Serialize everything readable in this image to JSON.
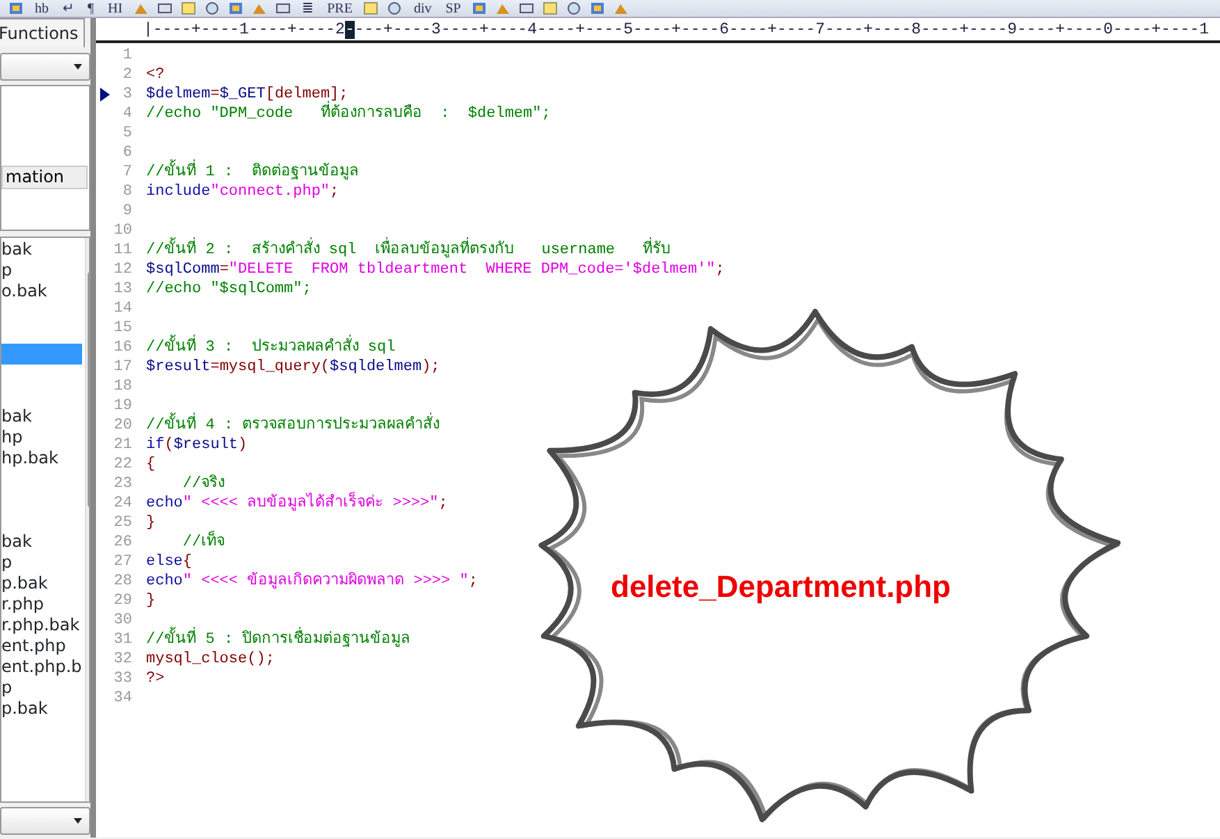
{
  "toolbar": {
    "items": [
      {
        "kind": "icon"
      },
      {
        "kind": "text",
        "label": "hb"
      },
      {
        "kind": "text",
        "label": "↵"
      },
      {
        "kind": "text",
        "label": "¶"
      },
      {
        "kind": "text",
        "label": "HI"
      },
      {
        "kind": "icon"
      },
      {
        "kind": "icon"
      },
      {
        "kind": "icon"
      },
      {
        "kind": "icon"
      },
      {
        "kind": "icon"
      },
      {
        "kind": "icon"
      },
      {
        "kind": "icon"
      },
      {
        "kind": "text",
        "label": "≣"
      },
      {
        "kind": "text",
        "label": "PRE"
      },
      {
        "kind": "icon"
      },
      {
        "kind": "icon"
      },
      {
        "kind": "text",
        "label": "div"
      },
      {
        "kind": "text",
        "label": "SP"
      },
      {
        "kind": "icon"
      },
      {
        "kind": "icon"
      },
      {
        "kind": "icon"
      },
      {
        "kind": "icon"
      },
      {
        "kind": "icon"
      },
      {
        "kind": "icon"
      },
      {
        "kind": "icon"
      }
    ]
  },
  "sidebar": {
    "tab": "Functions",
    "panel_button": "mation",
    "files": [
      {
        "label": "bak",
        "selected": false
      },
      {
        "label": "p",
        "selected": false
      },
      {
        "label": "o.bak",
        "selected": false
      },
      {
        "selected": false
      },
      {
        "selected": false
      },
      {
        "selected": true
      },
      {
        "selected": false
      },
      {
        "selected": false
      },
      {
        "label": "bak",
        "selected": false
      },
      {
        "label": "hp",
        "selected": false
      },
      {
        "label": "hp.bak",
        "selected": false
      },
      {
        "selected": false
      },
      {
        "selected": false
      },
      {
        "selected": false
      },
      {
        "label": "bak",
        "selected": false
      },
      {
        "label": "p",
        "selected": false
      },
      {
        "label": "p.bak",
        "selected": false
      },
      {
        "label": "r.php",
        "selected": false
      },
      {
        "label": "r.php.bak",
        "selected": false
      },
      {
        "label": "ent.php",
        "selected": false
      },
      {
        "label": "ent.php.b",
        "selected": false
      },
      {
        "label": "p",
        "selected": false
      },
      {
        "label": "p.bak",
        "selected": false
      }
    ]
  },
  "ruler": {
    "before": "|----+----1----+----2",
    "cursor": "-",
    "after": "---+----3----+----4----+----5----+----6----+----7----+----8----+----9----+----0----+----1"
  },
  "editor": {
    "lines": [
      {
        "number": "1",
        "current": false
      },
      {
        "number": "2",
        "current": false,
        "segments": [
          {
            "text": "<?",
            "kind": "plain"
          }
        ]
      },
      {
        "number": "3",
        "current": true,
        "segments": [
          {
            "text": "$delmem",
            "kind": "var"
          },
          {
            "text": "=",
            "kind": "plain"
          },
          {
            "text": "$_GET",
            "kind": "var"
          },
          {
            "text": "[delmem];",
            "kind": "plain"
          }
        ]
      },
      {
        "number": "4",
        "current": false,
        "segments": [
          {
            "text": "//echo \"DPM_code   ที่ต้องการลบคือ  :  $delmem\";",
            "kind": "comment"
          }
        ]
      },
      {
        "number": "5",
        "current": false
      },
      {
        "number": "6",
        "current": false
      },
      {
        "number": "7",
        "current": false,
        "segments": [
          {
            "text": "//ขั้นที่ 1 :  ติดต่อฐานข้อมูล",
            "kind": "comment"
          }
        ]
      },
      {
        "number": "8",
        "current": false,
        "segments": [
          {
            "text": "include",
            "kind": "keyword"
          },
          {
            "text": "\"connect.php\"",
            "kind": "string"
          },
          {
            "text": ";",
            "kind": "plain"
          }
        ]
      },
      {
        "number": "9",
        "current": false
      },
      {
        "number": "10",
        "current": false
      },
      {
        "number": "11",
        "current": false,
        "segments": [
          {
            "text": "//ขั้นที่ 2 :  สร้างคำสั่ง sql  เพื่อลบข้อมูลที่ตรงกับ   username   ที่รับ",
            "kind": "comment"
          }
        ]
      },
      {
        "number": "12",
        "current": false,
        "segments": [
          {
            "text": "$sqlComm",
            "kind": "var"
          },
          {
            "text": "=",
            "kind": "plain"
          },
          {
            "text": "\"DELETE  FROM tbldeartment  WHERE DPM_code='$delmem'\"",
            "kind": "string"
          },
          {
            "text": ";",
            "kind": "plain"
          }
        ]
      },
      {
        "number": "13",
        "current": false,
        "segments": [
          {
            "text": "//echo \"$sqlComm\";",
            "kind": "comment"
          }
        ]
      },
      {
        "number": "14",
        "current": false
      },
      {
        "number": "15",
        "current": false
      },
      {
        "number": "16",
        "current": false,
        "segments": [
          {
            "text": "//ขั้นที่ 3 :  ประมวลผลคำสั่ง sql",
            "kind": "comment"
          }
        ]
      },
      {
        "number": "17",
        "current": false,
        "segments": [
          {
            "text": "$result",
            "kind": "var"
          },
          {
            "text": "=mysql_query(",
            "kind": "plain"
          },
          {
            "text": "$sqldelmem",
            "kind": "var"
          },
          {
            "text": ");",
            "kind": "plain"
          }
        ]
      },
      {
        "number": "18",
        "current": false
      },
      {
        "number": "19",
        "current": false
      },
      {
        "number": "20",
        "current": false,
        "segments": [
          {
            "text": "//ขั้นที่ 4 : ตรวจสอบการประมวลผลคำสั่ง",
            "kind": "comment"
          }
        ]
      },
      {
        "number": "21",
        "current": false,
        "segments": [
          {
            "text": "if",
            "kind": "keyword"
          },
          {
            "text": "(",
            "kind": "plain"
          },
          {
            "text": "$result",
            "kind": "var"
          },
          {
            "text": ")",
            "kind": "plain"
          }
        ]
      },
      {
        "number": "22",
        "current": false,
        "segments": [
          {
            "text": "{",
            "kind": "plain"
          }
        ]
      },
      {
        "number": "23",
        "current": false,
        "segments": [
          {
            "text": "    //จริง",
            "kind": "comment"
          }
        ]
      },
      {
        "number": "24",
        "current": false,
        "segments": [
          {
            "text": "echo",
            "kind": "keyword"
          },
          {
            "text": "\" <<<< ลบข้อมูลได้สำเร็จค่ะ >>>>\"",
            "kind": "string"
          },
          {
            "text": ";",
            "kind": "plain"
          }
        ]
      },
      {
        "number": "25",
        "current": false,
        "segments": [
          {
            "text": "}",
            "kind": "plain"
          }
        ]
      },
      {
        "number": "26",
        "current": false,
        "segments": [
          {
            "text": "    //เท็จ",
            "kind": "comment"
          }
        ]
      },
      {
        "number": "27",
        "current": false,
        "segments": [
          {
            "text": "else",
            "kind": "keyword"
          },
          {
            "text": "{",
            "kind": "plain"
          }
        ]
      },
      {
        "number": "28",
        "current": false,
        "segments": [
          {
            "text": "echo",
            "kind": "keyword"
          },
          {
            "text": "\" <<<< ข้อมูลเกิดความผิดพลาด >>>> \"",
            "kind": "string"
          },
          {
            "text": ";",
            "kind": "plain"
          }
        ]
      },
      {
        "number": "29",
        "current": false,
        "segments": [
          {
            "text": "}",
            "kind": "plain"
          }
        ]
      },
      {
        "number": "30",
        "current": false
      },
      {
        "number": "31",
        "current": false,
        "segments": [
          {
            "text": "//ขั้นที่ 5 : ปิดการเชื่อมต่อฐานข้อมูล",
            "kind": "comment"
          }
        ]
      },
      {
        "number": "32",
        "current": false,
        "segments": [
          {
            "text": "mysql_close();",
            "kind": "plain"
          }
        ]
      },
      {
        "number": "33",
        "current": false,
        "segments": [
          {
            "text": "?>",
            "kind": "plain"
          }
        ]
      },
      {
        "number": "34",
        "current": false
      }
    ]
  },
  "bubble": {
    "label": "delete_Department.php"
  }
}
